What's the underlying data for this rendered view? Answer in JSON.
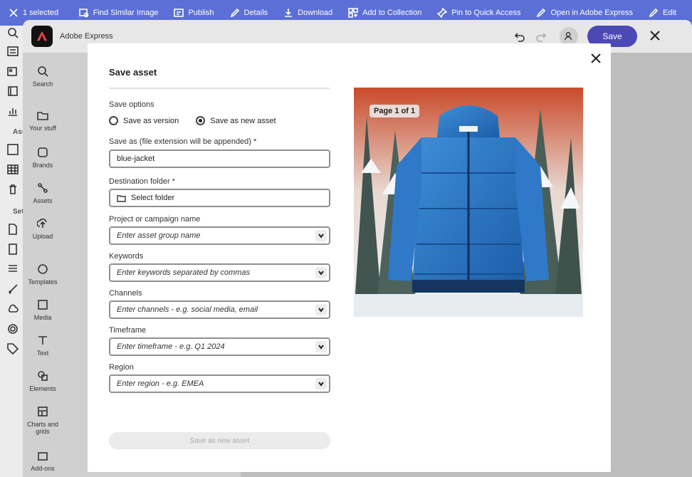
{
  "topbar": {
    "selected": "1 selected",
    "actions": [
      "Find Similar Image",
      "Publish",
      "Details",
      "Download",
      "Add to Collection",
      "Pin to Quick Access",
      "Open in Adobe Express",
      "Edit"
    ]
  },
  "leftstrip": {
    "ass": "Ass",
    "set": "Set"
  },
  "express": {
    "title": "Adobe Express",
    "save_label": "Save"
  },
  "nav": {
    "items": [
      "Search",
      "Your stuff",
      "Brands",
      "Assets",
      "Upload",
      "Templates",
      "Media",
      "Text",
      "Elements",
      "Charts and grids",
      "Add-ons"
    ]
  },
  "modal": {
    "title": "Save asset",
    "save_options_label": "Save options",
    "opt_version": "Save as version",
    "opt_new": "Save as new asset",
    "save_as_label": "Save as (file extension will be appended)",
    "save_as_value": "blue-jacket",
    "destination_label": "Destination folder",
    "destination_value": "Select folder",
    "project_label": "Project or campaign name",
    "project_placeholder": "Enter asset group name",
    "keywords_label": "Keywords",
    "keywords_placeholder": "Enter keywords separated by commas",
    "channels_label": "Channels",
    "channels_placeholder": "Enter channels - e.g. social media, email",
    "timeframe_label": "Timeframe",
    "timeframe_placeholder": "Enter timeframe - e.g. Q1 2024",
    "region_label": "Region",
    "region_placeholder": "Enter region - e.g. EMEA",
    "submit_label": "Save as new asset",
    "page_badge": "Page 1 of 1",
    "required": "*"
  }
}
